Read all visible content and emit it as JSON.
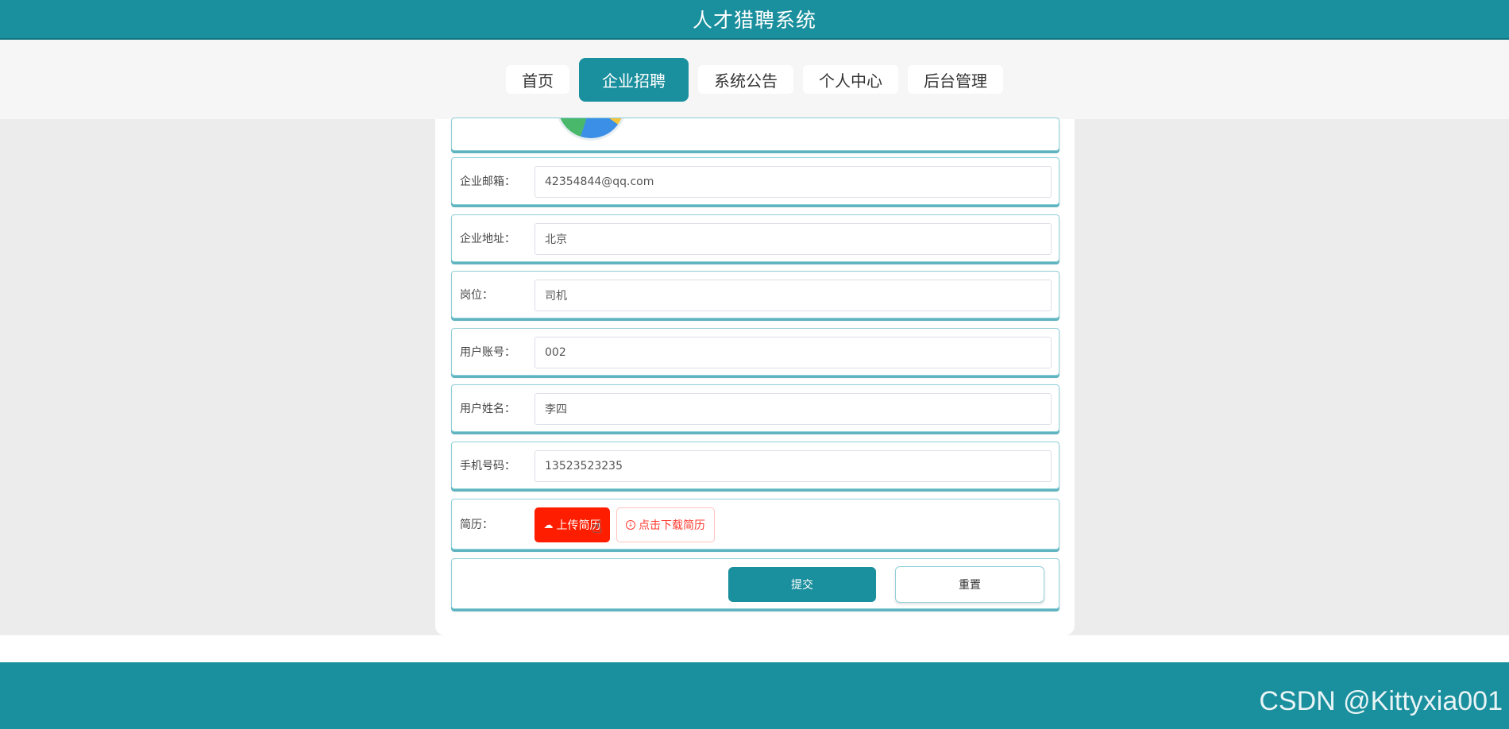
{
  "app": {
    "title": "人才猎聘系统"
  },
  "nav": {
    "items": [
      {
        "label": "首页"
      },
      {
        "label": "企业招聘"
      },
      {
        "label": "系统公告"
      },
      {
        "label": "个人中心"
      },
      {
        "label": "后台管理"
      }
    ],
    "active_index": 1
  },
  "form": {
    "fields": [
      {
        "label": "企业邮箱：",
        "value": "42354844@qq.com"
      },
      {
        "label": "企业地址：",
        "value": "北京"
      },
      {
        "label": "岗位：",
        "value": "司机"
      },
      {
        "label": "用户账号：",
        "value": "002"
      },
      {
        "label": "用户姓名：",
        "value": "李四"
      },
      {
        "label": "手机号码：",
        "value": "13523523235"
      }
    ],
    "resume": {
      "label": "简历：",
      "upload_label": "上传简历",
      "download_label": "点击下载简历"
    },
    "submit_label": "提交",
    "reset_label": "重置"
  },
  "colors": {
    "primary": "#1a8f9d",
    "danger": "#ff1d00",
    "background": "#ececec"
  },
  "watermark": "CSDN @Kittyxia001"
}
